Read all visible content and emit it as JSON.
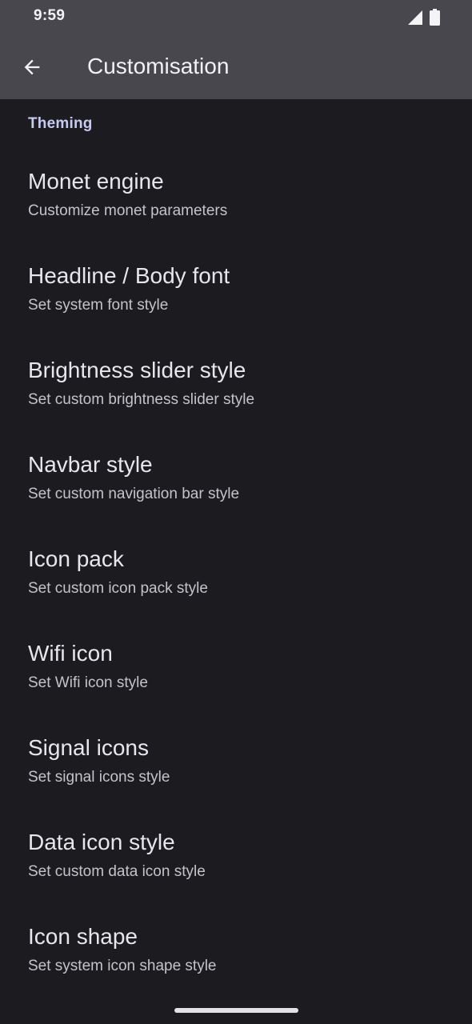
{
  "status_bar": {
    "time": "9:59",
    "signal_icon": "cellular-signal-icon",
    "battery_icon": "battery-full-icon"
  },
  "app_bar": {
    "back_icon": "arrow-back-icon",
    "title": "Customisation"
  },
  "section": {
    "header": "Theming"
  },
  "items": [
    {
      "title": "Monet engine",
      "summary": "Customize monet parameters"
    },
    {
      "title": "Headline / Body font",
      "summary": "Set system font style"
    },
    {
      "title": "Brightness slider style",
      "summary": "Set custom brightness slider style"
    },
    {
      "title": "Navbar style",
      "summary": "Set custom navigation bar style"
    },
    {
      "title": "Icon pack",
      "summary": "Set custom icon pack style"
    },
    {
      "title": "Wifi icon",
      "summary": "Set Wifi icon style"
    },
    {
      "title": "Signal icons",
      "summary": "Set signal icons style"
    },
    {
      "title": "Data icon style",
      "summary": "Set custom data icon style"
    },
    {
      "title": "Icon shape",
      "summary": "Set system icon shape style"
    }
  ],
  "colors": {
    "top_bar_background": "#47474d",
    "page_background": "#1c1c20",
    "section_header": "#c7cbf1",
    "title_text": "#e7e6ec",
    "summary_text": "#c4c3ca"
  }
}
